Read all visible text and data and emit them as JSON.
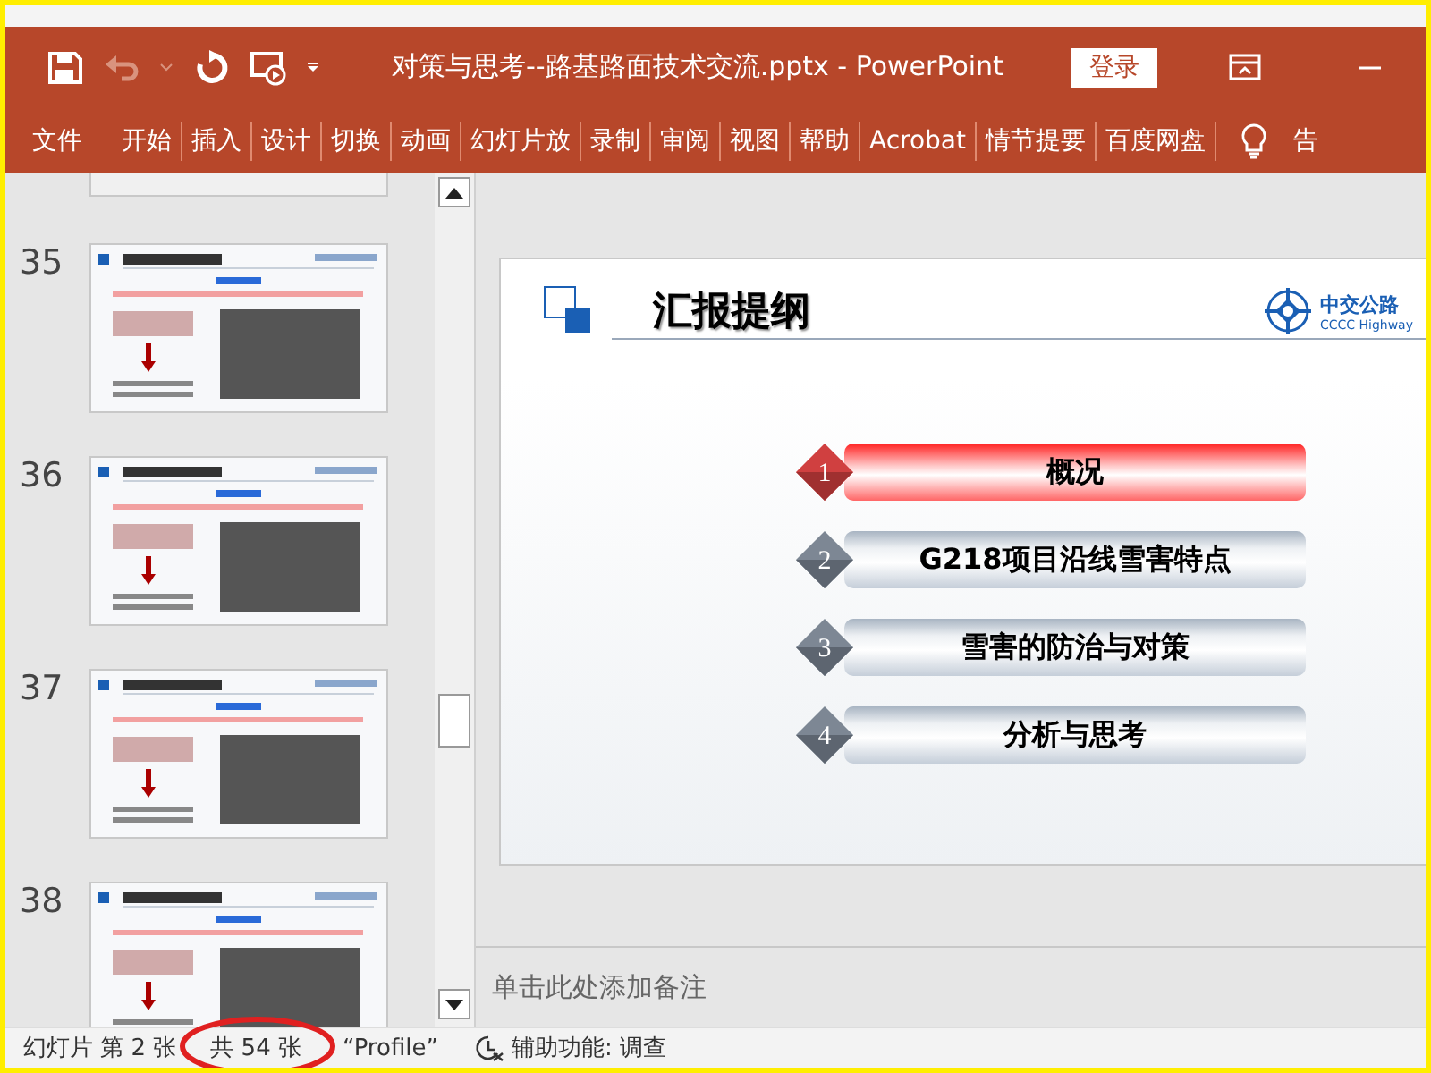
{
  "title_bar": {
    "title": "对策与思考--路基路面技术交流.pptx  -  PowerPoint",
    "login_button": "登录"
  },
  "ribbon_tabs": [
    {
      "label": "文件"
    },
    {
      "label": "开始"
    },
    {
      "label": "插入"
    },
    {
      "label": "设计"
    },
    {
      "label": "切换"
    },
    {
      "label": "动画"
    },
    {
      "label": "幻灯片放"
    },
    {
      "label": "录制"
    },
    {
      "label": "审阅"
    },
    {
      "label": "视图"
    },
    {
      "label": "帮助"
    },
    {
      "label": "Acrobat"
    },
    {
      "label": "情节提要"
    },
    {
      "label": "百度网盘"
    }
  ],
  "tell_me": "告",
  "thumbnails": [
    {
      "number": "35"
    },
    {
      "number": "36"
    },
    {
      "number": "37"
    },
    {
      "number": "38"
    }
  ],
  "slide": {
    "title": "汇报提纲",
    "logo_text": "中交公路",
    "logo_subtext": "CCCC Highway",
    "outline": [
      {
        "number": "1",
        "label": "概况",
        "highlighted": true
      },
      {
        "number": "2",
        "label": "G218项目沿线雪害特点",
        "highlighted": false
      },
      {
        "number": "3",
        "label": "雪害的防治与对策",
        "highlighted": false
      },
      {
        "number": "4",
        "label": "分析与思考",
        "highlighted": false
      }
    ]
  },
  "notes": {
    "placeholder": "单击此处添加备注"
  },
  "status_bar": {
    "slide_position": "幻灯片 第 2 张",
    "slide_total": "共 54 张",
    "theme": "“Profile”",
    "accessibility": "辅助功能: 调查"
  }
}
